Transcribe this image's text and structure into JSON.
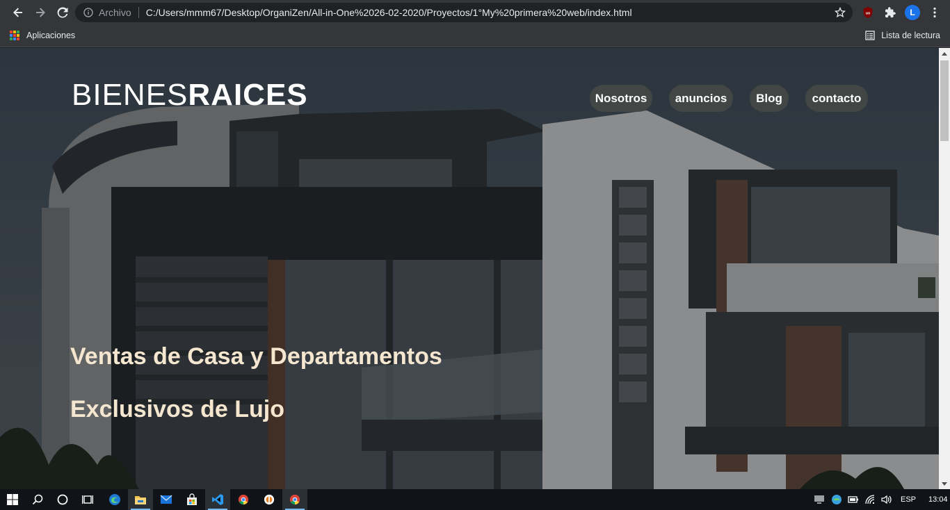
{
  "browser": {
    "omnibox_scheme": "Archivo",
    "url": "C:/Users/mmm67/Desktop/OrganiZen/All-in-One%2026-02-2020/Proyectos/1°My%20primera%20web/index.html",
    "profile_initial": "L",
    "extension_badge": "uo"
  },
  "bookmarks": {
    "apps_label": "Aplicaciones",
    "reading_list_label": "Lista de lectura"
  },
  "page": {
    "logo_thin": "BIENES",
    "logo_bold": "RAICES",
    "nav": [
      "Nosotros",
      "anuncios",
      "Blog",
      "contacto"
    ],
    "headline_1": "Ventas de Casa y Departamentos",
    "headline_2": "Exclusivos de Lujo"
  },
  "taskbar": {
    "language": "ESP",
    "time": "13:04"
  },
  "colors": {
    "headline": "#f5e6cf",
    "nav_pill": "#464a48",
    "chrome_dark": "#35363a"
  }
}
